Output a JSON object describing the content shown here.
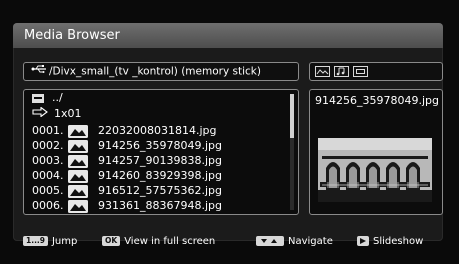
{
  "window": {
    "title": "Media Browser"
  },
  "path": {
    "icon": "usb-icon",
    "text": "/Divx_small_(tv _kontrol) (memory stick)"
  },
  "view_modes": [
    {
      "icon": "photo-view-icon",
      "selected": false
    },
    {
      "icon": "music-view-icon",
      "selected": false
    },
    {
      "icon": "video-view-icon",
      "selected": false
    }
  ],
  "file_list": {
    "parent": "../",
    "current_folder": "1x01",
    "files": [
      {
        "number": "0001.",
        "name": "22032008031814.jpg"
      },
      {
        "number": "0002.",
        "name": "914256_35978049.jpg"
      },
      {
        "number": "0003.",
        "name": "914257_90139838.jpg"
      },
      {
        "number": "0004.",
        "name": "914260_83929398.jpg"
      },
      {
        "number": "0005.",
        "name": "916512_57575362.jpg"
      },
      {
        "number": "0006.",
        "name": "931361_88367948.jpg"
      }
    ]
  },
  "preview": {
    "filename": "914256_35978049.jpg"
  },
  "footer": {
    "jump": {
      "key": "1...9",
      "label": "Jump"
    },
    "view": {
      "key": "OK",
      "label": "View in full screen"
    },
    "navigate": {
      "label": "Navigate"
    },
    "slideshow": {
      "label": "Slideshow"
    }
  },
  "colors": {
    "title_bar": "#5e5e5e",
    "background": "#1b1b1b",
    "border": "#8a8a8a",
    "text": "#ffffff"
  }
}
